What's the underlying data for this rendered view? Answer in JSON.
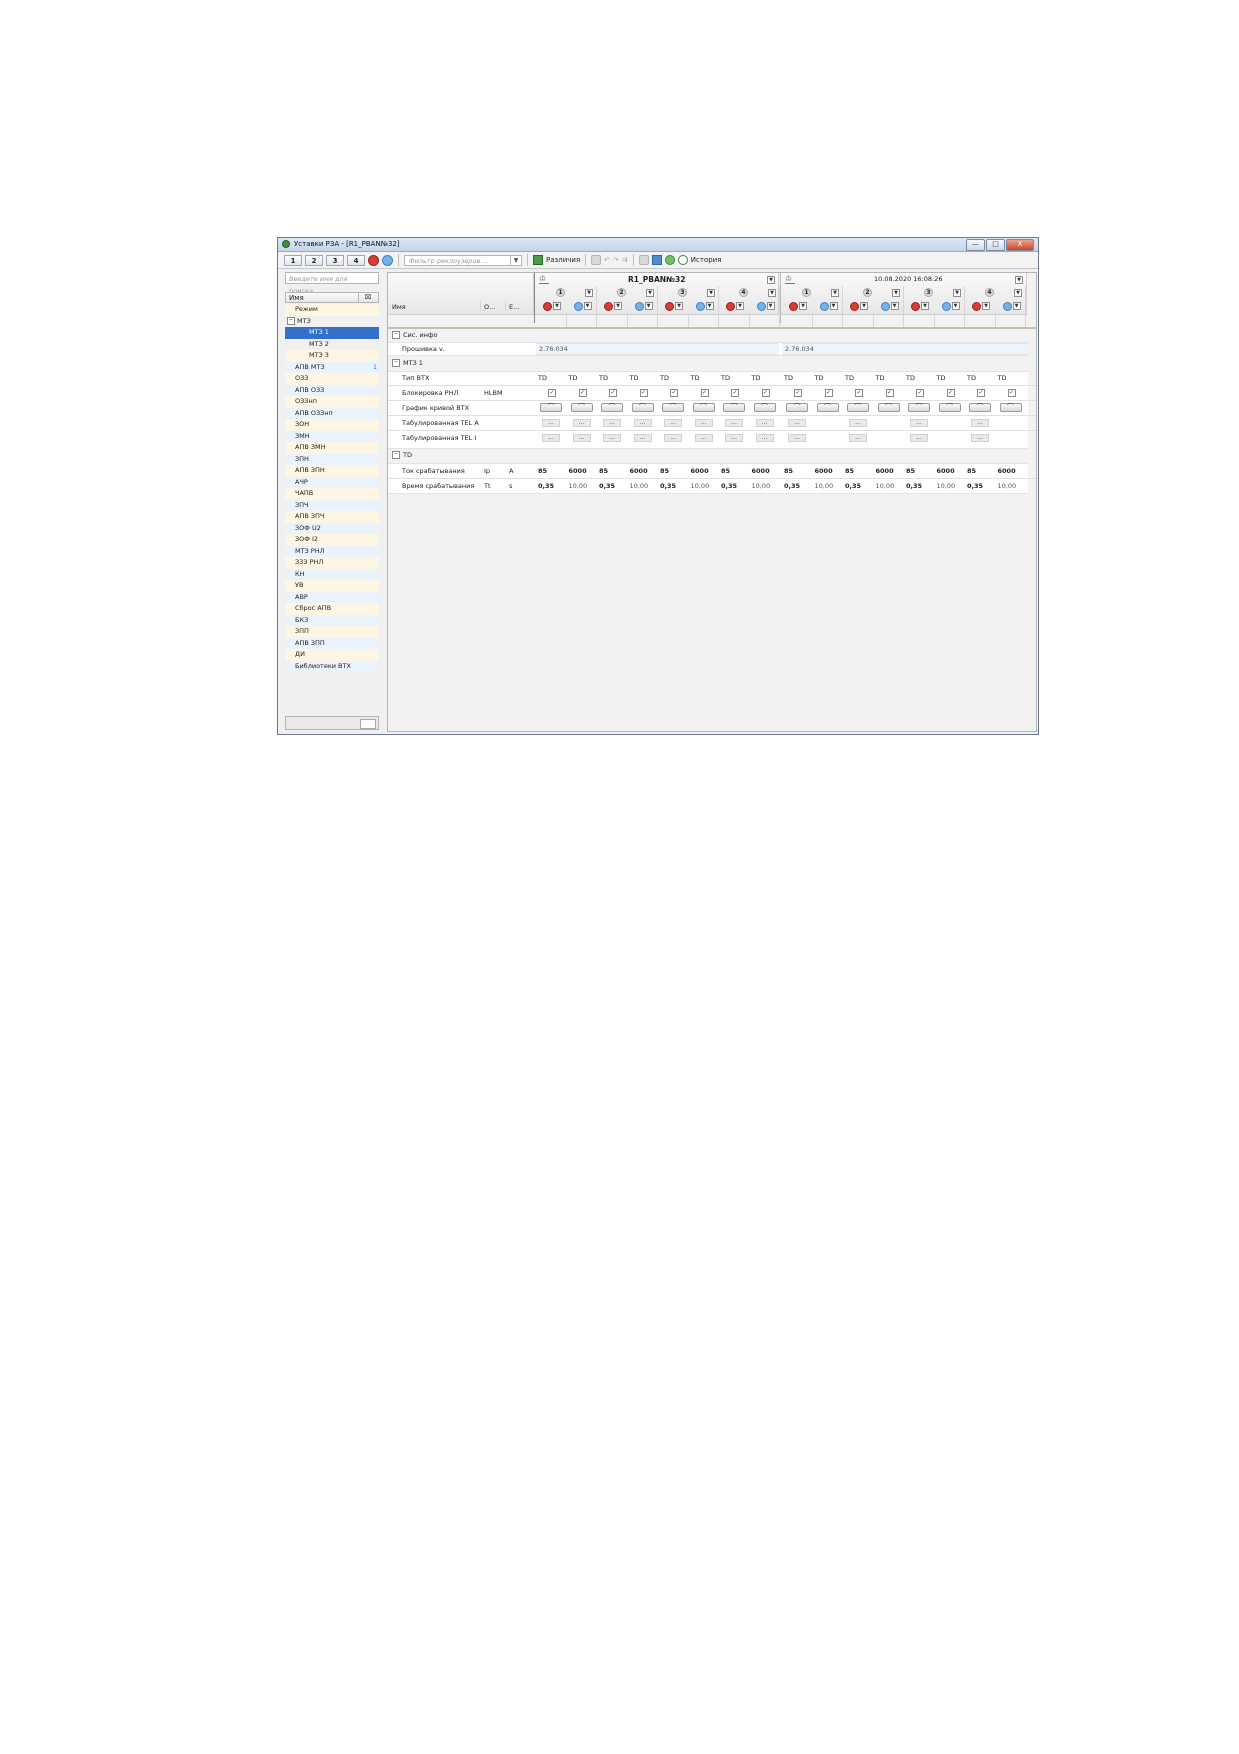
{
  "window": {
    "title": "Уставки РЗА - [R1_PBAN№32]",
    "buttons": [
      "—",
      "□",
      "X"
    ]
  },
  "toolbar": {
    "tabs": [
      "1",
      "2",
      "3",
      "4"
    ],
    "filter_placeholder": "Фильтр реклоузеров ...",
    "diff_label": "Различия",
    "history_label": "История"
  },
  "left": {
    "search_placeholder": "Введите имя для поиска...",
    "column_header": "Имя",
    "tree": [
      {
        "label": "Режим",
        "level": 1,
        "style": "alt"
      },
      {
        "label": "МТЗ",
        "level": 0,
        "expander": "−",
        "style": ""
      },
      {
        "label": "МТЗ 1",
        "level": 2,
        "style": "sel"
      },
      {
        "label": "МТЗ 2",
        "level": 2,
        "style": ""
      },
      {
        "label": "МТЗ 3",
        "level": 2,
        "style": "alt"
      },
      {
        "label": "АПВ МТЗ",
        "level": 1,
        "style": "alt2",
        "badge": "1"
      },
      {
        "label": "ОЗЗ",
        "level": 1,
        "style": "alt"
      },
      {
        "label": "АПВ ОЗЗ",
        "level": 1,
        "style": "alt2"
      },
      {
        "label": "ОЗЗнп",
        "level": 1,
        "style": "alt"
      },
      {
        "label": "АПВ ОЗЗнп",
        "level": 1,
        "style": "alt2"
      },
      {
        "label": "ЗОН",
        "level": 1,
        "style": "alt"
      },
      {
        "label": "ЗМН",
        "level": 1,
        "style": "alt2"
      },
      {
        "label": "АПВ ЗМН",
        "level": 1,
        "style": "alt"
      },
      {
        "label": "ЗПН",
        "level": 1,
        "style": "alt2"
      },
      {
        "label": "АПВ ЗПН",
        "level": 1,
        "style": "alt"
      },
      {
        "label": "АЧР",
        "level": 1,
        "style": "alt2"
      },
      {
        "label": "ЧАПВ",
        "level": 1,
        "style": "alt"
      },
      {
        "label": "ЗПЧ",
        "level": 1,
        "style": "alt2"
      },
      {
        "label": "АПВ ЗПЧ",
        "level": 1,
        "style": "alt"
      },
      {
        "label": "ЗОФ U2",
        "level": 1,
        "style": "alt2"
      },
      {
        "label": "ЗОФ I2",
        "level": 1,
        "style": "alt"
      },
      {
        "label": "МТЗ РНЛ",
        "level": 1,
        "style": "alt2"
      },
      {
        "label": "ЗЗЗ РНЛ",
        "level": 1,
        "style": "alt"
      },
      {
        "label": "КН",
        "level": 1,
        "style": "alt2"
      },
      {
        "label": "УВ",
        "level": 1,
        "style": "alt"
      },
      {
        "label": "АВР",
        "level": 1,
        "style": "alt2"
      },
      {
        "label": "Сброс АПВ",
        "level": 1,
        "style": "alt"
      },
      {
        "label": "БКЗ",
        "level": 1,
        "style": "alt2"
      },
      {
        "label": "ЗПП",
        "level": 1,
        "style": "alt"
      },
      {
        "label": "АПВ ЗПП",
        "level": 1,
        "style": "alt2"
      },
      {
        "label": "ДИ",
        "level": 1,
        "style": "alt"
      },
      {
        "label": "Библиотеки ВТХ",
        "level": 1,
        "style": "alt2"
      }
    ]
  },
  "grid": {
    "group1_title": "R1_PBAN№32",
    "group2_title": "10.08.2020 16:08:26",
    "set_numbers": [
      "1",
      "2",
      "3",
      "4"
    ],
    "col_name": "Имя",
    "col_o": "О...",
    "col_e": "Е...",
    "sec_sys": "Сис. инфо",
    "firmware_label": "Прошивка v.",
    "firmware_v1": "2.76.034",
    "firmware_v2": "2.76.034",
    "sec_mtz1": "МТЗ 1",
    "vtx_type_label": "Тип ВТХ",
    "vtx_type_value": "TD",
    "block_label": "Блокировка РНЛ",
    "block_o": "HLBM",
    "curve_label": "График кривой ВТХ",
    "tabA_label": "Табулированная TEL A",
    "tabI_label": "Табулированная TEL I",
    "dots": "...",
    "sec_td": "TD",
    "current_label": "Ток срабатывания",
    "current_o": "Ip",
    "current_e": "A",
    "time_label": "Время срабатывания",
    "time_o": "Tt",
    "time_e": "s",
    "current_values": [
      "85",
      "6000",
      "85",
      "6000",
      "85",
      "6000",
      "85",
      "6000",
      "85",
      "6000",
      "85",
      "6000",
      "85",
      "6000",
      "85",
      "6000"
    ],
    "time_values": [
      "0,35",
      "10,00",
      "0,35",
      "10,00",
      "0,35",
      "10,00",
      "0,35",
      "10,00",
      "0,35",
      "10,00",
      "0,35",
      "10,00",
      "0,35",
      "10,00",
      "0,35",
      "10,00"
    ]
  }
}
